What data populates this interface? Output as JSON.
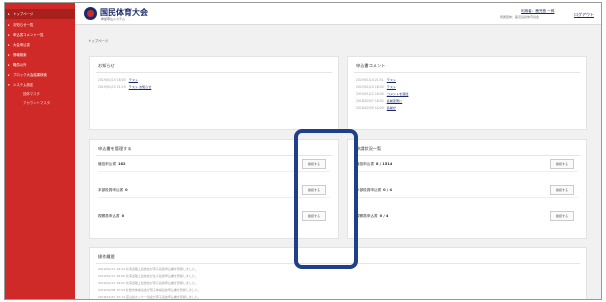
{
  "sidebar": {
    "items": [
      {
        "label": "トップページ"
      },
      {
        "label": "お知らせ一覧"
      },
      {
        "label": "申込書コメント一覧"
      },
      {
        "label": "大会申込書"
      },
      {
        "label": "情報検索"
      },
      {
        "label": "職員以外"
      },
      {
        "label": "ブロック大会結果検索"
      },
      {
        "label": "システム設定"
      },
      {
        "label": "団体マスタ"
      },
      {
        "label": "アカウントマスタ"
      }
    ]
  },
  "header": {
    "title": "国民体育大会",
    "subtitle": "参加申込システム",
    "user_name": "利用者：鹿児島 一郎",
    "user_org": "所属団体：鹿児島県体育協会",
    "logout": "ログアウト"
  },
  "breadcrumb": "トップページ",
  "notices": {
    "title": "お知らせ",
    "rows": [
      {
        "date": "2019/01/15 18:00",
        "text": "テスト"
      },
      {
        "date": "2019/01/15 21:19",
        "text": "テスト お知らせ"
      }
    ]
  },
  "comments": {
    "title": "申込書コメント",
    "rows": [
      {
        "date": "2019/01/14 21:51",
        "text": "テスト"
      },
      {
        "date": "2019/01/10 18:00",
        "text": "テスト"
      },
      {
        "date": "2019/01/12 18:00",
        "text": "コメントを追加"
      },
      {
        "date": "2018/02/07 18:02",
        "text": "名前変更に"
      },
      {
        "date": "2018/02/05 14:29",
        "text": "名前が"
      }
    ]
  },
  "manage": {
    "title": "申込書を管理する",
    "rows": [
      {
        "label": "競技申込書",
        "count": "162",
        "button": "確認する"
      },
      {
        "label": "本部役員申込書",
        "count": "0",
        "button": "確認する"
      },
      {
        "label": "視察員申込書",
        "count": "0",
        "button": "確認する"
      }
    ]
  },
  "status": {
    "title": "申請状況一覧",
    "rows": [
      {
        "label": "競技申込書",
        "count": "8 / 1514",
        "button": "確認する"
      },
      {
        "label": "本部役員申込書",
        "count": "0 / 4",
        "button": "確認する"
      },
      {
        "label": "視察員申込書",
        "count": "0 / 4",
        "button": "確認する"
      }
    ]
  },
  "history": {
    "title": "操作履歴",
    "rows": [
      {
        "date": "2019/01/11 18:24",
        "text": "北海道陸上競技会が男子競技申込書を登録しました。"
      },
      {
        "date": "2019/01/11 18:06",
        "text": "北海道陸上競技会が女子競技申込書を登録しました。"
      },
      {
        "date": "2019/01/11 18:02",
        "text": "北海道陸上競技会が男子競技申込書を登録しました。"
      },
      {
        "date": "2019/01/08 15:04",
        "text": "札幌市体操協会が男子体操競技申込書を登録しました。"
      },
      {
        "date": "2018/12/27 15:14",
        "text": "富山県ホッケー協会が男子競技申込書を登録しました。"
      }
    ]
  },
  "colors": {
    "sidebar": "#cf2a27",
    "sidebar_active": "#a81f1c",
    "brand_navy": "#1b2a6b",
    "highlight": "#1f3f88",
    "content_bg": "#f1f1f1"
  }
}
